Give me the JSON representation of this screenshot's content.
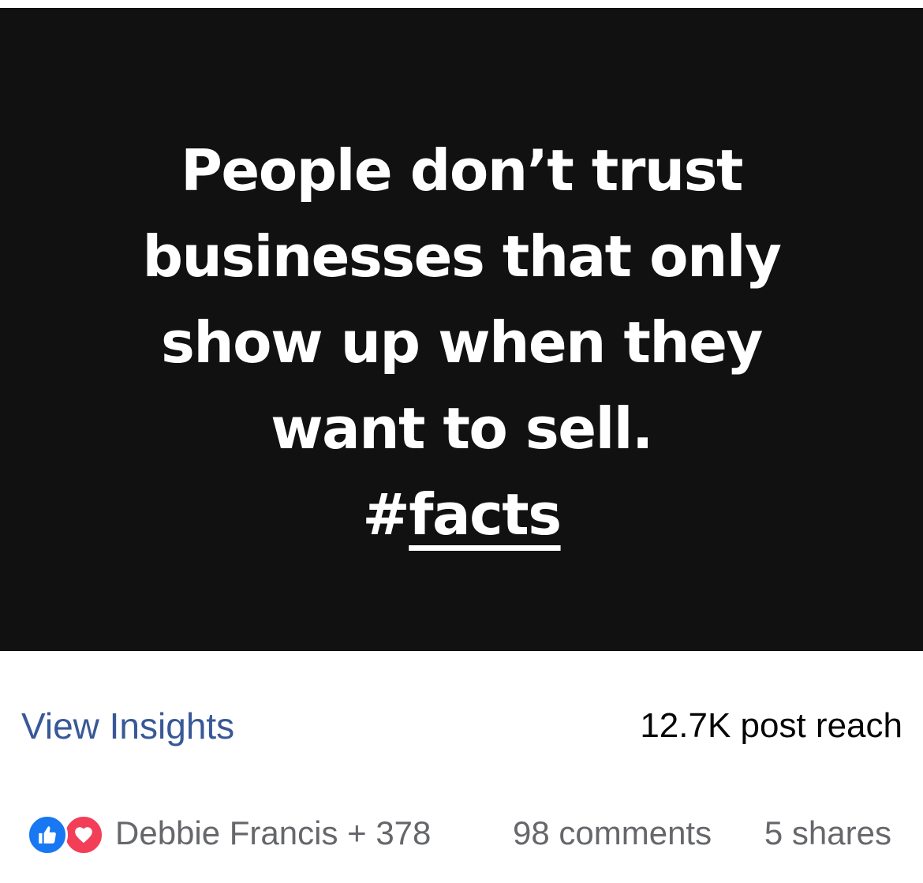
{
  "post": {
    "quote_lines": [
      "People don’t trust",
      "businesses that only",
      "show up when they",
      "want to sell."
    ],
    "hashtag_symbol": "#",
    "hashtag_text": "facts",
    "background_color": "#111111",
    "text_color": "#ffffff"
  },
  "insights": {
    "link_label": "View Insights",
    "reach_text": "12.7K post reach",
    "link_color": "#385898"
  },
  "engagement": {
    "reaction_icons": [
      "like-icon",
      "love-icon"
    ],
    "reactors_text": "Debbie Francis + 378",
    "comments_text": "98 comments",
    "shares_text": "5 shares",
    "like_color": "#1877f2",
    "love_color": "#f33e58"
  }
}
